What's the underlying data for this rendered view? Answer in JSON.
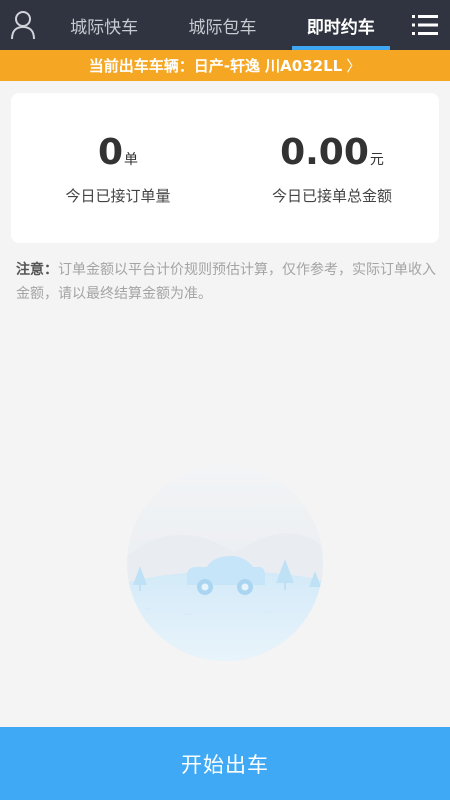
{
  "header": {
    "user_icon": "user-icon",
    "menu_icon": "list-menu-icon",
    "tabs": [
      {
        "label": "城际快车",
        "active": false
      },
      {
        "label": "城际包车",
        "active": false
      },
      {
        "label": "即时约车",
        "active": true
      }
    ]
  },
  "vehicle_bar": {
    "label": "当前出车车辆：日产-轩逸 川A032LL",
    "chevron": "〉"
  },
  "stats": {
    "orders": {
      "value": "0",
      "unit": "单",
      "label": "今日已接订单量"
    },
    "amount": {
      "value": "0.00",
      "unit": "元",
      "label": "今日已接单总金额"
    }
  },
  "notice": {
    "label": "注意：",
    "text": "订单金额以平台计价规则预估计算，仅作参考，实际订单收入金额，请以最终结算金额为准。"
  },
  "illustration": {
    "icon": "car-empty-illustration"
  },
  "start_button": {
    "label": "开始出车"
  },
  "colors": {
    "header_bg": "#2f3440",
    "tab_active_underline": "#3fa6f1",
    "vehicle_bar_bg": "#f5a623",
    "start_button_bg": "#3fa9f5"
  }
}
